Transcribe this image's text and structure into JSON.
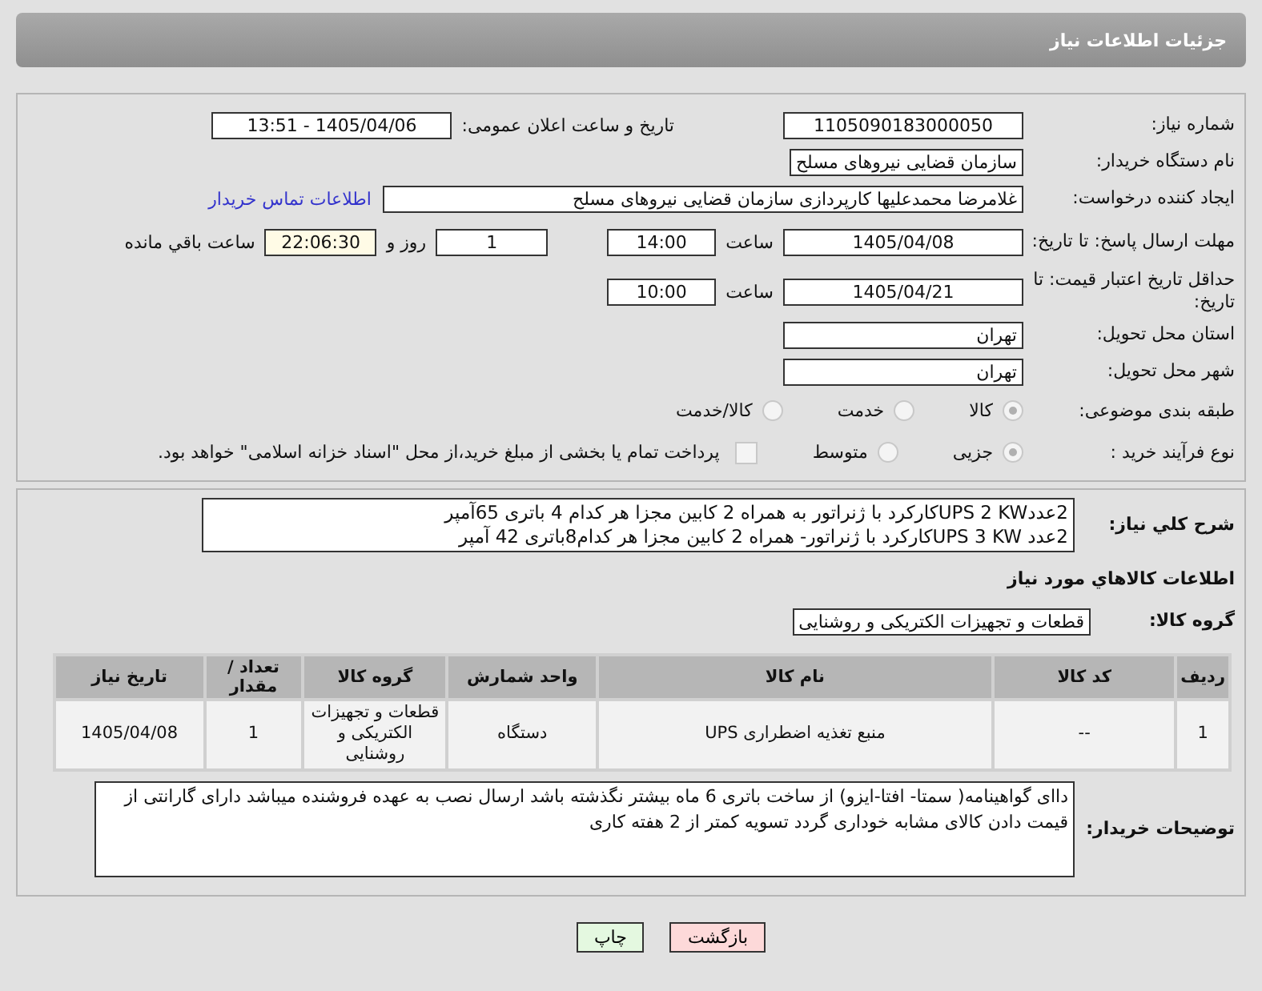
{
  "header": {
    "title": "جزئیات اطلاعات نیاز"
  },
  "form": {
    "need_number": {
      "label": "شماره نیاز:",
      "value": "1105090183000050"
    },
    "announce": {
      "label": "تاریخ و ساعت اعلان عمومی:",
      "value": "1405/04/06 - 13:51"
    },
    "buyer_org": {
      "label": "نام دستگاه خریدار:",
      "value": "سازمان قضایی نیروهای مسلح"
    },
    "creator": {
      "label": "ایجاد کننده درخواست:",
      "value": "غلامرضا  محمدعلیها کارپردازی سازمان قضایی نیروهای مسلح",
      "link": "اطلاعات تماس خریدار"
    },
    "deadline": {
      "label": "مهلت ارسال پاسخ: تا تاریخ:",
      "date": "1405/04/08",
      "time_label": "ساعت",
      "time": "14:00",
      "days": "1",
      "days_label": "روز و",
      "remaining": "22:06:30",
      "remaining_label": "ساعت باقي مانده"
    },
    "validity": {
      "label": "حداقل تاریخ اعتبار قیمت: تا تاریخ:",
      "date": "1405/04/21",
      "time_label": "ساعت",
      "time": "10:00"
    },
    "province": {
      "label": "استان محل تحویل:",
      "value": "تهران"
    },
    "city": {
      "label": "شهر محل تحویل:",
      "value": "تهران"
    },
    "category": {
      "label": "طبقه بندی موضوعی:",
      "options": [
        {
          "label": "كالا",
          "selected": true
        },
        {
          "label": "خدمت",
          "selected": false
        },
        {
          "label": "كالا/خدمت",
          "selected": false
        }
      ]
    },
    "process": {
      "label": "نوع فرآیند خرید :",
      "options": [
        {
          "label": "جزیی",
          "selected": true
        },
        {
          "label": "متوسط",
          "selected": false
        }
      ],
      "treasury": {
        "label": "پرداخت تمام یا بخشی از مبلغ خرید،از محل \"اسناد خزانه اسلامی\" خواهد بود.",
        "checked": false
      }
    }
  },
  "details": {
    "description": {
      "label": "شرح کلي نياز:",
      "lines": [
        "2عددUPS 2 KWکارکرد با ژنراتور به همراه 2 کابین مجزا هر کدام 4 باتری 65آمپر",
        "2عدد UPS 3 KWکارکرد با ژنراتور- همراه 2 کابین مجزا هر کدام8باتری 42 آمپر"
      ]
    },
    "goods_heading": "اطلاعات كالاهاي مورد نياز",
    "goods_group": {
      "label": "گروه کالا:",
      "value": "قطعات و تجهیزات الکتریکی و روشنایی"
    },
    "table": {
      "columns": [
        "رديف",
        "کد کالا",
        "نام کالا",
        "واحد شمارش",
        "گروه کالا",
        "تعداد / مقدار",
        "تاریخ نیاز"
      ],
      "rows": [
        [
          "1",
          "--",
          "منبع تغذیه اضطراری UPS",
          "دستگاه",
          "قطعات و تجهیزات الکتریکی و روشنایی",
          "1",
          "1405/04/08"
        ]
      ]
    },
    "buyer_notes": {
      "label": "توضیحات خریدار:",
      "value": "داای گواهینامه( سمتا- افتا-ایزو) از ساخت باتری 6 ماه بیشتر نگذشته باشد ارسال  نصب به عهده فروشنده میباشد دارای گارانتی از قیمت دادن کالای مشابه خوداری گردد تسویه کمتر از 2 هفته کاری"
    }
  },
  "buttons": [
    {
      "label": "بازگشت",
      "kind": "back"
    },
    {
      "label": "چاپ",
      "kind": "print"
    }
  ]
}
